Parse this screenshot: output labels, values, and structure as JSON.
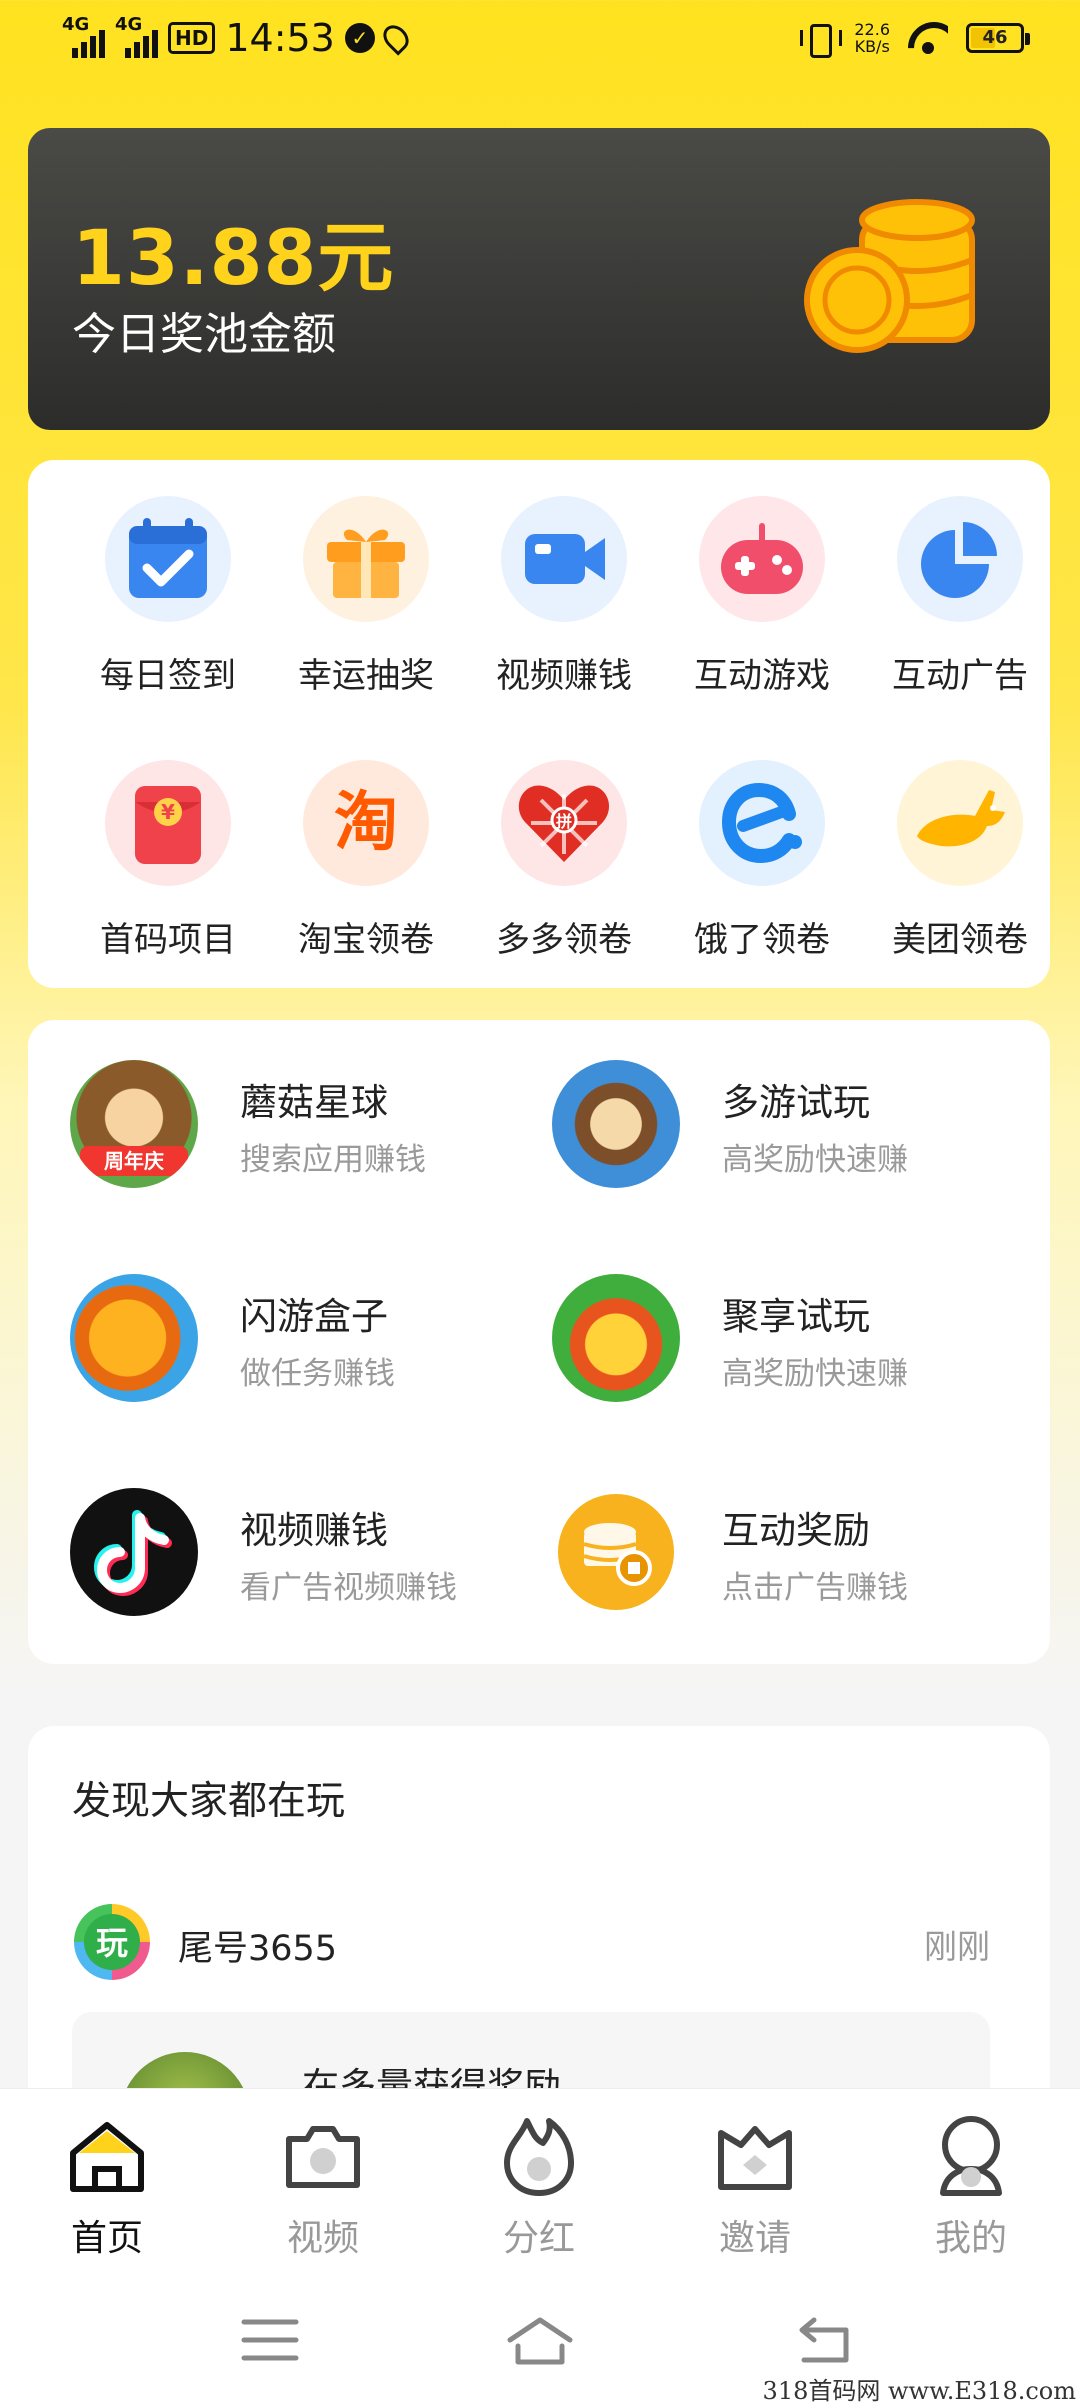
{
  "status_bar": {
    "network1": "4G",
    "network2": "4G",
    "hd": "HD",
    "time": "14:53",
    "speed_value": "22.6",
    "speed_unit": "KB/s",
    "battery": "46"
  },
  "prize": {
    "amount": "13.88元",
    "label": "今日奖池金额"
  },
  "grid": {
    "items": [
      {
        "label": "每日签到",
        "icon": "calendar-check-icon"
      },
      {
        "label": "幸运抽奖",
        "icon": "gift-icon"
      },
      {
        "label": "视频赚钱",
        "icon": "video-camera-icon"
      },
      {
        "label": "互动游戏",
        "icon": "gamepad-icon"
      },
      {
        "label": "互动广告",
        "icon": "pie-chart-icon"
      },
      {
        "label": "首码项目",
        "icon": "red-envelope-icon"
      },
      {
        "label": "淘宝领卷",
        "icon": "taobao-icon"
      },
      {
        "label": "多多领卷",
        "icon": "pinduoduo-icon"
      },
      {
        "label": "饿了领卷",
        "icon": "eleme-icon"
      },
      {
        "label": "美团领卷",
        "icon": "meituan-kangaroo-icon"
      }
    ],
    "taobao_glyph": "淘",
    "pdd_glyph": "拼",
    "hongbao_glyph": "¥"
  },
  "apps": {
    "items": [
      {
        "title": "蘑菇星球",
        "sub": "搜索应用赚钱",
        "badge": "周年庆"
      },
      {
        "title": "多游试玩",
        "sub": "高奖励快速赚"
      },
      {
        "title": "闪游盒子",
        "sub": "做任务赚钱"
      },
      {
        "title": "聚享试玩",
        "sub": "高奖励快速赚"
      },
      {
        "title": "视频赚钱",
        "sub": "看广告视频赚钱"
      },
      {
        "title": "互动奖励",
        "sub": "点击广告赚钱"
      }
    ]
  },
  "feed": {
    "title": "发现大家都在玩",
    "user_avatar_glyph": "玩",
    "user_name": "尾号3655",
    "time": "刚刚",
    "message": "在多量获得奖励"
  },
  "tabbar": {
    "tabs": [
      {
        "label": "首页",
        "icon": "home-icon",
        "active": true
      },
      {
        "label": "视频",
        "icon": "camera-icon"
      },
      {
        "label": "分红",
        "icon": "flame-icon"
      },
      {
        "label": "邀请",
        "icon": "crown-icon"
      },
      {
        "label": "我的",
        "icon": "profile-icon"
      }
    ]
  },
  "watermark": "318首码网 www.E318.com",
  "colors": {
    "brand_yellow": "#FFE21F",
    "amount_gold": "#FFD21C",
    "card_dark": "#3A3A38"
  }
}
